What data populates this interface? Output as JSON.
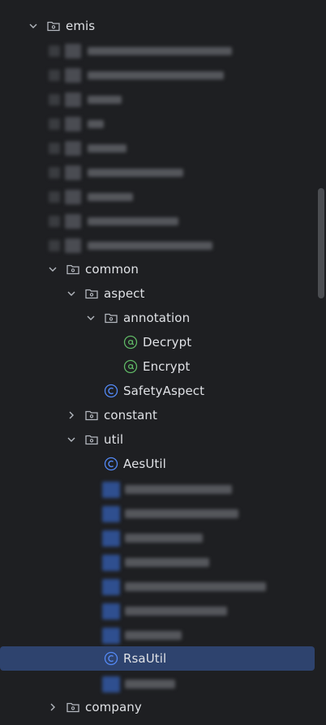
{
  "tree": {
    "emis": "emis",
    "common": "common",
    "aspect": "aspect",
    "annotation": "annotation",
    "decrypt": "Decrypt",
    "encrypt": "Encrypt",
    "safety_aspect": "SafetyAspect",
    "constant": "constant",
    "util": "util",
    "aes_util": "AesUtil",
    "rsa_util": "RsaUtil",
    "company": "company"
  },
  "colors": {
    "background": "#1e1f22",
    "selection": "#2e436e",
    "class_icon": "#548af7",
    "annotation_icon": "#5fb865",
    "text": "#dfe1e5"
  }
}
